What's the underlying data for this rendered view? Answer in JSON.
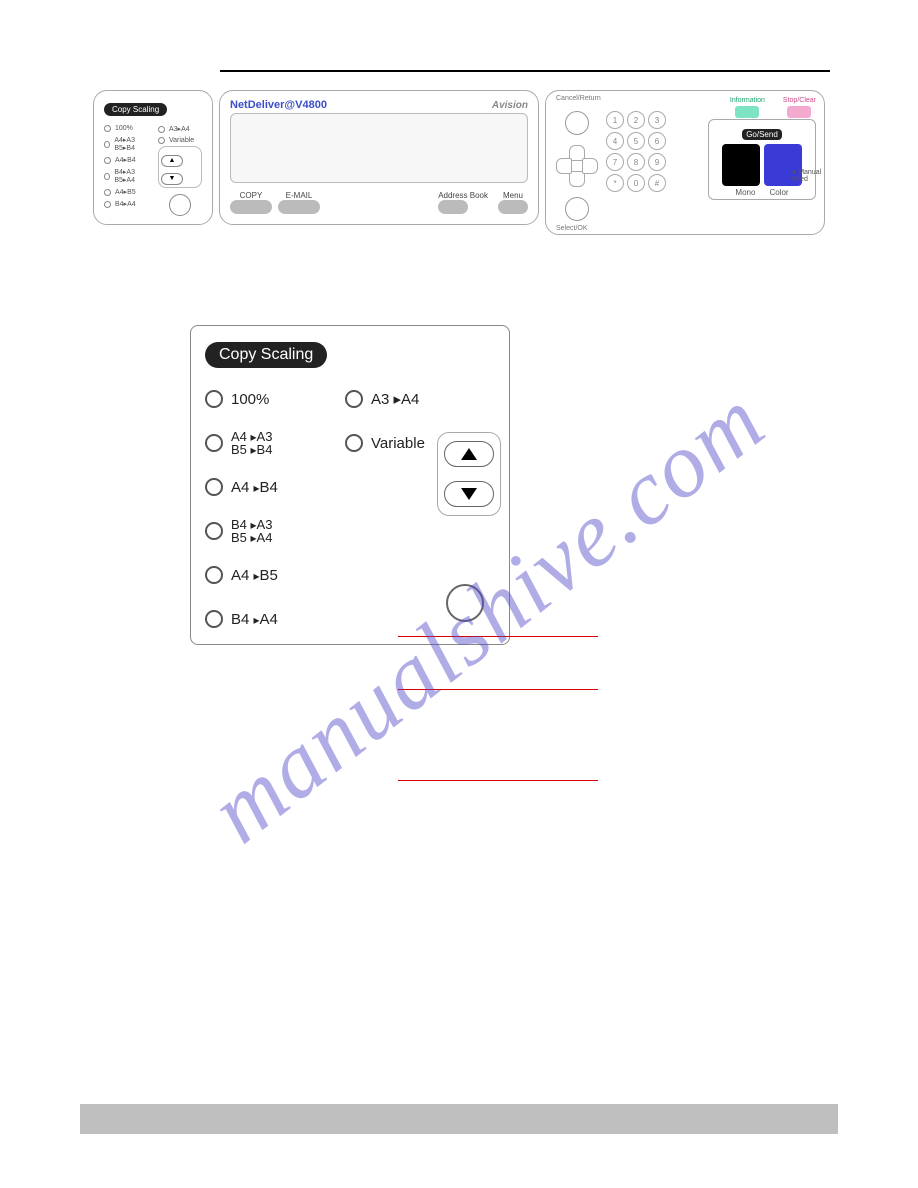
{
  "header": {
    "divider": true
  },
  "main_panel": {
    "block_a": {
      "title": "Copy Scaling",
      "rows": [
        {
          "left": "100%",
          "right": "A3▸A4"
        },
        {
          "left": "A4▸A3 B5▸B4",
          "right": "Variable"
        },
        {
          "left": "A4▸B4",
          "right_buttons": true
        },
        {
          "left": "B4▸A3 B5▸A4"
        },
        {
          "left": "A4▸B5"
        },
        {
          "left": "B4▸A4"
        }
      ]
    },
    "block_b": {
      "brand": "NetDeliver@V4800",
      "brand_right": "Avision",
      "bottom": {
        "copy": "COPY",
        "email": "E-MAIL",
        "addrbook": "Address Book",
        "menu": "Menu"
      }
    },
    "block_c": {
      "cancel_label": "Cancel/Return",
      "keypad": [
        "1",
        "2",
        "3",
        "4",
        "5",
        "6",
        "7",
        "8",
        "9",
        "*",
        "0",
        "#"
      ],
      "info_label": "Information",
      "stop_label": "Stop/Clear",
      "gosend_title": "Go/Send",
      "mono": "Mono",
      "color": "Color",
      "manual": "Manual Feed",
      "select_label": "Select/OK"
    }
  },
  "copy_scaling_detail": {
    "title": "Copy Scaling",
    "options_col1": [
      "100%",
      "A4 ▸A3\nB5 ▸B4",
      "A4 ▸B4",
      "B4 ▸A3\nB5 ▸A4",
      "A4 ▸B5",
      "B4 ▸A4"
    ],
    "options_col2_top": [
      "A3 ▸A4",
      "Variable"
    ]
  },
  "watermark_text": "manualshive.com"
}
